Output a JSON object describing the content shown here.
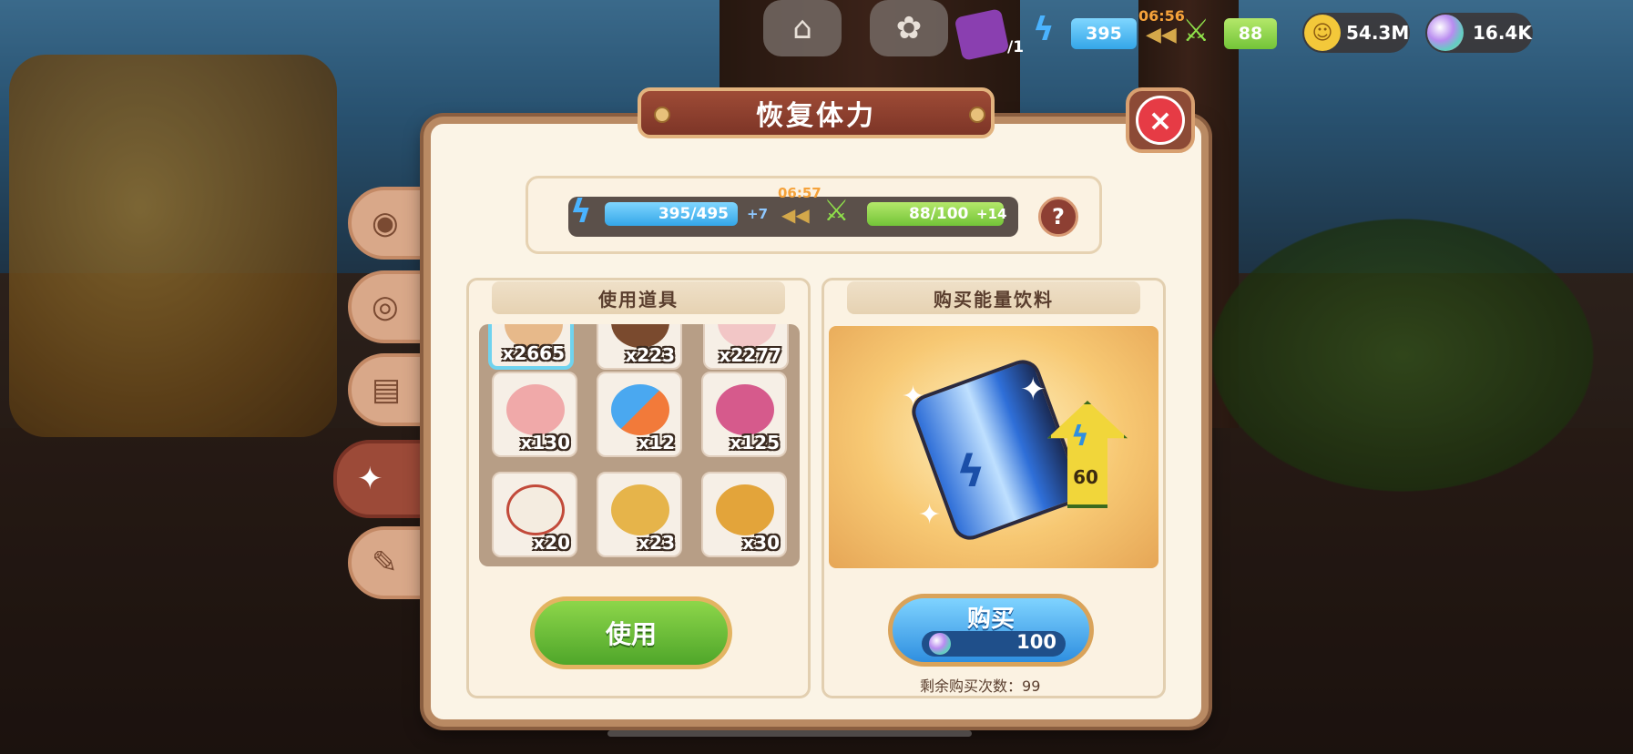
{
  "top_bar": {
    "lives_count": "/1",
    "stamina": "395",
    "timer": "06:56",
    "food": "88",
    "coins": "54.3M",
    "gems": "16.4K"
  },
  "dialog": {
    "title": "恢复体力",
    "stamina_bar": {
      "blue_text": "395/495",
      "blue_bonus": "+7",
      "timer": "06:57",
      "green_text": "88/100",
      "green_bonus": "+14",
      "progress_stamina": 0.798,
      "progress_food": 0.88
    },
    "help_label": "?",
    "left_panel": {
      "header": "使用道具",
      "items": [
        {
          "count": "x2665",
          "icon": "bread-icon",
          "color": "#e7b98a"
        },
        {
          "count": "x223",
          "icon": "chocolate-icon",
          "color": "#7a4a2e"
        },
        {
          "count": "x2277",
          "icon": "donut-icon",
          "color": "#f2c6c6"
        },
        {
          "count": "x130",
          "icon": "mochi-icon",
          "color": "#f0a9a9"
        },
        {
          "count": "x12",
          "icon": "popsicle-icon",
          "color": "#f27a3a"
        },
        {
          "count": "x125",
          "icon": "candy-icon",
          "color": "#d65a8c"
        },
        {
          "count": "x20",
          "icon": "dumpling-icon",
          "color": "#f4ece0"
        },
        {
          "count": "x23",
          "icon": "pineapple-bun-icon",
          "color": "#e6b44a"
        },
        {
          "count": "x30",
          "icon": "pastry-icon",
          "color": "#e3a43a"
        }
      ],
      "use_button": "使用"
    },
    "right_panel": {
      "header": "购买能量饮料",
      "drink_amount": "60",
      "buy_button": "购买",
      "price": "100",
      "remaining_label": "剩余购买次数：",
      "remaining_value": "99"
    }
  },
  "colors": {
    "accent_red": "#8d3f33",
    "stamina_blue": "#34a6e8",
    "food_green": "#73c438",
    "gold": "#e3b461"
  }
}
